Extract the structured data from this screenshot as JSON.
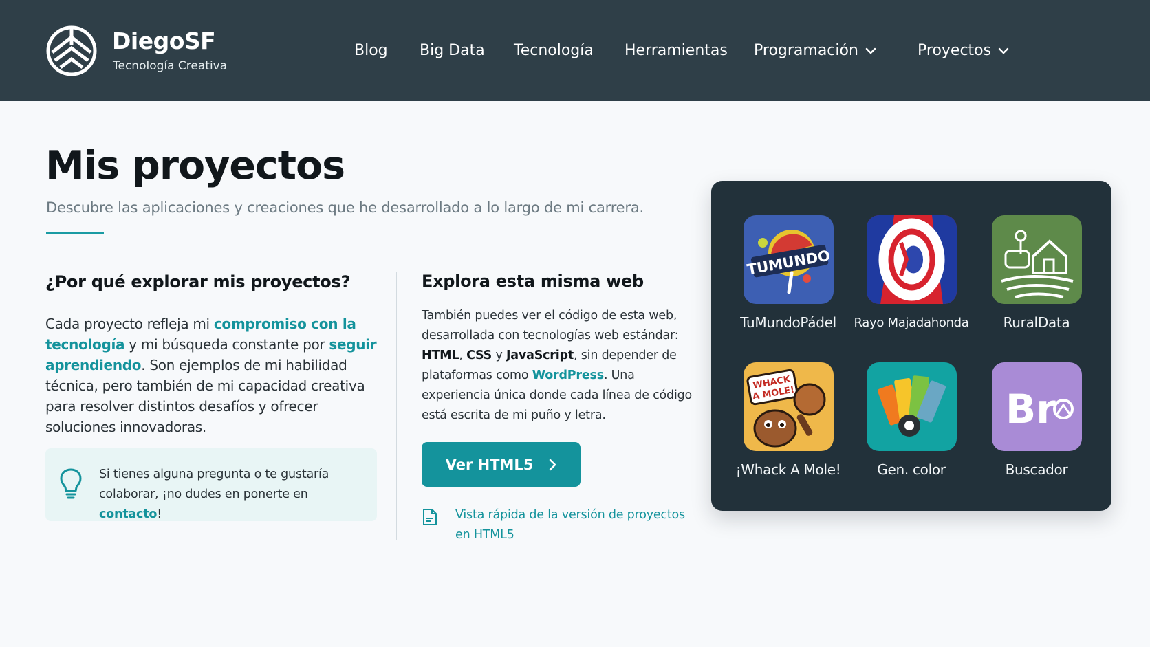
{
  "brand": {
    "name": "DiegoSF",
    "tagline": "Tecnología Creativa",
    "logo_icon": "wolf-logo-icon"
  },
  "nav": {
    "items": [
      {
        "label": "Blog",
        "dropdown": false
      },
      {
        "label": "Big Data",
        "dropdown": false
      },
      {
        "label": "Tecnología",
        "dropdown": false
      },
      {
        "label": "Herramientas",
        "dropdown": false
      },
      {
        "label": "Programación",
        "dropdown": true
      },
      {
        "label": "Proyectos",
        "dropdown": true
      }
    ]
  },
  "hero": {
    "title": "Mis proyectos",
    "subtitle": "Descubre las aplicaciones y creaciones que he desarrollado a lo largo de mi carrera."
  },
  "why": {
    "heading": "¿Por qué explorar mis proyectos?",
    "p1": "Cada proyecto refleja mi ",
    "hl1": "compromiso con la tecnología",
    "p2": " y mi búsqueda constante por ",
    "hl2": "seguir aprendiendo",
    "p3": ". Son ejemplos de mi habilidad técnica, pero también de mi capacidad creativa para resolver distintos desafíos y ofrecer soluciones innovadoras."
  },
  "tip": {
    "icon": "lightbulb-icon",
    "text": "Si tienes alguna pregunta o te gustaría colaborar, ¡no dudes en ponerte en ",
    "link": "contacto",
    "end": "!"
  },
  "web": {
    "heading": "Explora esta misma web",
    "t1": "También puedes ver el código de esta web, desarrollada con tecnologías web estándar: ",
    "b1": "HTML",
    "t2": ", ",
    "b2": "CSS",
    "t3": " y ",
    "b3": "JavaScript",
    "t4": ", sin depender de plataformas como ",
    "link": "WordPress",
    "t5": ". Una experiencia única donde cada línea de código está escrita de mi puño y letra.",
    "button": "Ver HTML5",
    "quick_link": "Vista rápida de la versión de proyectos en HTML5"
  },
  "apps": [
    {
      "name": "TuMundoPádel",
      "icon": "tumundo-padel-icon"
    },
    {
      "name": "Rayo Majadahonda",
      "icon": "rayo-majadahonda-icon"
    },
    {
      "name": "RuralData",
      "icon": "ruraldata-icon"
    },
    {
      "name": "¡Whack A Mole!",
      "icon": "whack-a-mole-icon"
    },
    {
      "name": "Gen. color",
      "icon": "color-generator-icon"
    },
    {
      "name": "Buscador",
      "icon": "buscador-icon"
    }
  ],
  "app_art": {
    "tumundo_text": "TUMUNDO",
    "whack_text_1": "WHACK",
    "whack_text_2": "A MOLE!",
    "buscador_text": "Br"
  },
  "colors": {
    "header_bg": "#2f3f48",
    "accent": "#14939c",
    "panel_bg": "#22313a"
  }
}
